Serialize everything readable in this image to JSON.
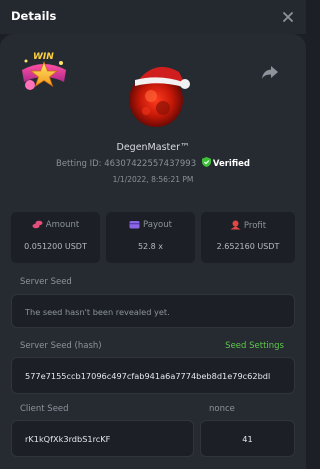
{
  "window": {
    "title": "Details"
  },
  "badge": {
    "text": "WIN"
  },
  "user": {
    "name": "DegenMaster™",
    "betting_id_label": "Betting ID: 46307422557437993",
    "verified_label": "Verified",
    "date": "1/1/2022, 8:56:21 PM"
  },
  "stats": {
    "amount": {
      "label": "Amount",
      "value": "0.051200 USDT"
    },
    "payout": {
      "label": "Payout",
      "value": "52.8 x"
    },
    "profit": {
      "label": "Profit",
      "value": "2.652160 USDT"
    }
  },
  "server_seed": {
    "label": "Server Seed",
    "value": "The seed hasn't been revealed yet."
  },
  "server_seed_hash": {
    "label": "Server Seed (hash)",
    "settings_link": "Seed Settings",
    "value": "577e7155ccb17096c497cfab941a6a7774beb8d1e79c62bdl"
  },
  "client_seed": {
    "label": "Client Seed",
    "value": "rK1kQfXk3rdbS1rcKF"
  },
  "nonce": {
    "label": "nonce",
    "value": "41"
  },
  "colors": {
    "background": "#1c2026",
    "panel": "#262b32",
    "accent_green": "#5fc84a",
    "amount_icon": "#e0507a",
    "payout_icon": "#8a66e6",
    "profit_icon": "#e04848"
  }
}
